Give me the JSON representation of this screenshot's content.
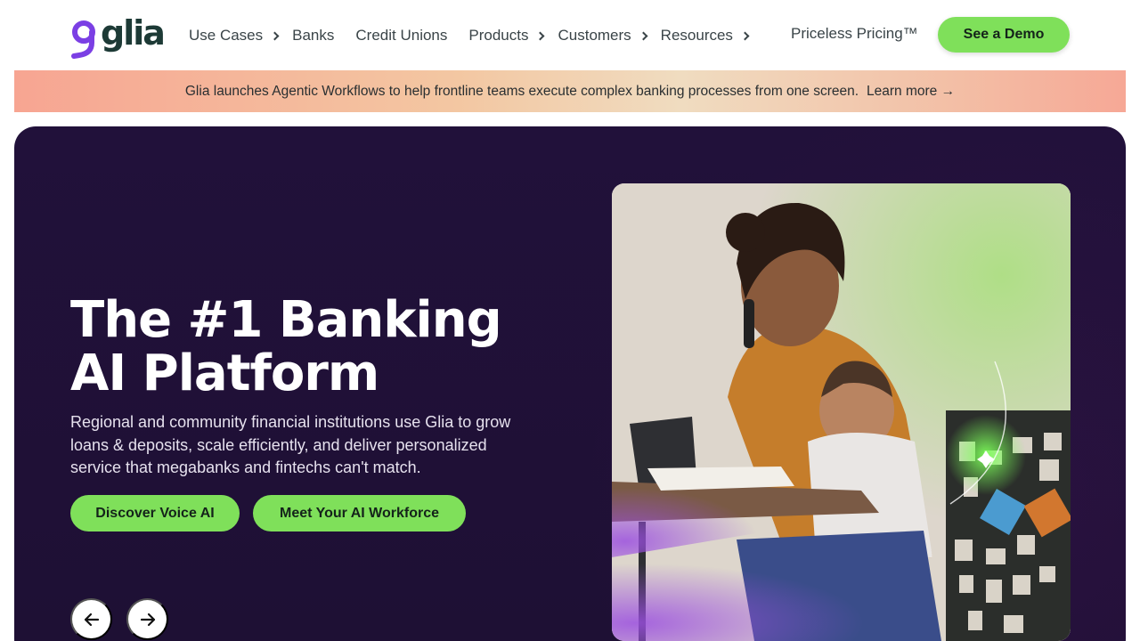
{
  "brand": {
    "name": "glia",
    "accent": "#7b3fe4",
    "cta_color": "#7fe05a",
    "hero_bg": "#21113a"
  },
  "nav": {
    "items": [
      {
        "label": "Use Cases",
        "has_submenu": true
      },
      {
        "label": "Banks",
        "has_submenu": false
      },
      {
        "label": "Credit Unions",
        "has_submenu": false
      },
      {
        "label": "Products",
        "has_submenu": true
      },
      {
        "label": "Customers",
        "has_submenu": true
      },
      {
        "label": "Resources",
        "has_submenu": true
      }
    ],
    "pricing_label": "Priceless Pricing™",
    "demo_label": "See a Demo"
  },
  "banner": {
    "text": "Glia launches Agentic Workflows to help frontline teams execute complex banking processes from one screen.",
    "link_label": "Learn more →"
  },
  "hero": {
    "title": "The #1 Banking AI Platform",
    "subtitle": "Regional and community financial institutions use Glia to grow loans & deposits, scale efficiently, and deliver personalized service that megabanks and fintechs can't match.",
    "cta_primary": "Discover Voice AI",
    "cta_secondary": "Meet Your AI Workforce",
    "prev_icon": "arrow-left-icon",
    "next_icon": "arrow-right-icon",
    "image_subject": "woman-on-phone-with-baby-photo"
  }
}
